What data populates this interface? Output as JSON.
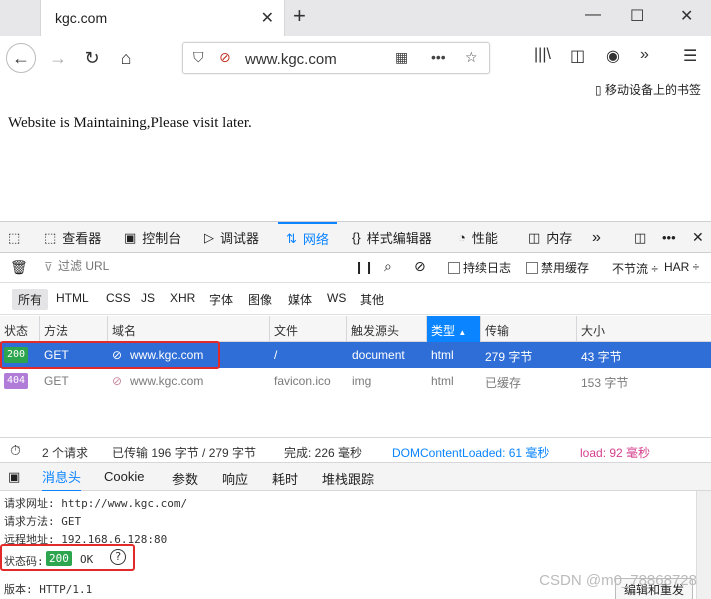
{
  "browser": {
    "tab_title": "kgc.com",
    "tab_close": "✕",
    "new_tab": "+",
    "minimize": "—",
    "maximize": "☐",
    "close": "✕",
    "url": "www.kgc.com",
    "bookmarks_label": "移动设备上的书签"
  },
  "page": {
    "message": "Website is Maintaining,Please visit later."
  },
  "devtools": {
    "tabs": [
      {
        "icon": "⬚",
        "label": "查看器"
      },
      {
        "icon": "▣",
        "label": "控制台"
      },
      {
        "icon": "▷",
        "label": "调试器"
      },
      {
        "icon": "⇅",
        "label": "网络"
      },
      {
        "icon": "{}",
        "label": "样式编辑器"
      },
      {
        "icon": "◔",
        "label": "性能"
      },
      {
        "icon": "◫",
        "label": "内存"
      }
    ],
    "more": "»",
    "filter_placeholder": "过滤 URL",
    "persist_logs": "持续日志",
    "disable_cache": "禁用缓存",
    "throttle": "不节流 ÷",
    "har": "HAR ÷",
    "type_filters": [
      "所有",
      "HTML",
      "CSS",
      "JS",
      "XHR",
      "字体",
      "图像",
      "媒体",
      "WS",
      "其他"
    ],
    "columns": [
      "状态",
      "方法",
      "域名",
      "文件",
      "触发源头",
      "类型",
      "传输",
      "大小"
    ],
    "rows": [
      {
        "status": "200",
        "method": "GET",
        "domain": "www.kgc.com",
        "file": "/",
        "cause": "document",
        "type": "html",
        "transfer": "279 字节",
        "size": "43 字节"
      },
      {
        "status": "404",
        "method": "GET",
        "domain": "www.kgc.com",
        "file": "favicon.ico",
        "cause": "img",
        "type": "html",
        "transfer": "已缓存",
        "size": "153 字节"
      }
    ],
    "summary": {
      "requests": "2 个请求",
      "transferred": "已传输 196 字节 / 279 字节",
      "finish": "完成: 226 毫秒",
      "dcl": "DOMContentLoaded: 61 毫秒",
      "load": "load: 92 毫秒"
    },
    "detail_tabs": [
      "消息头",
      "Cookie",
      "参数",
      "响应",
      "耗时",
      "堆栈跟踪"
    ],
    "headers": {
      "request_url": "请求网址: http://www.kgc.com/",
      "request_method": "请求方法: GET",
      "remote_addr": "远程地址: 192.168.6.128:80",
      "status_label": "状态码:",
      "status_code": "200",
      "status_text": "OK",
      "version": "版本: HTTP/1.1"
    },
    "edit_resend": "编辑和重发"
  },
  "watermark": "CSDN @m0_78868728",
  "colors": {
    "accent": "#0a84ff",
    "selected_row": "#2f6ed6",
    "status_ok": "#2da44e",
    "status_404": "#b07cd8",
    "highlight_box": "#e22a2a"
  }
}
